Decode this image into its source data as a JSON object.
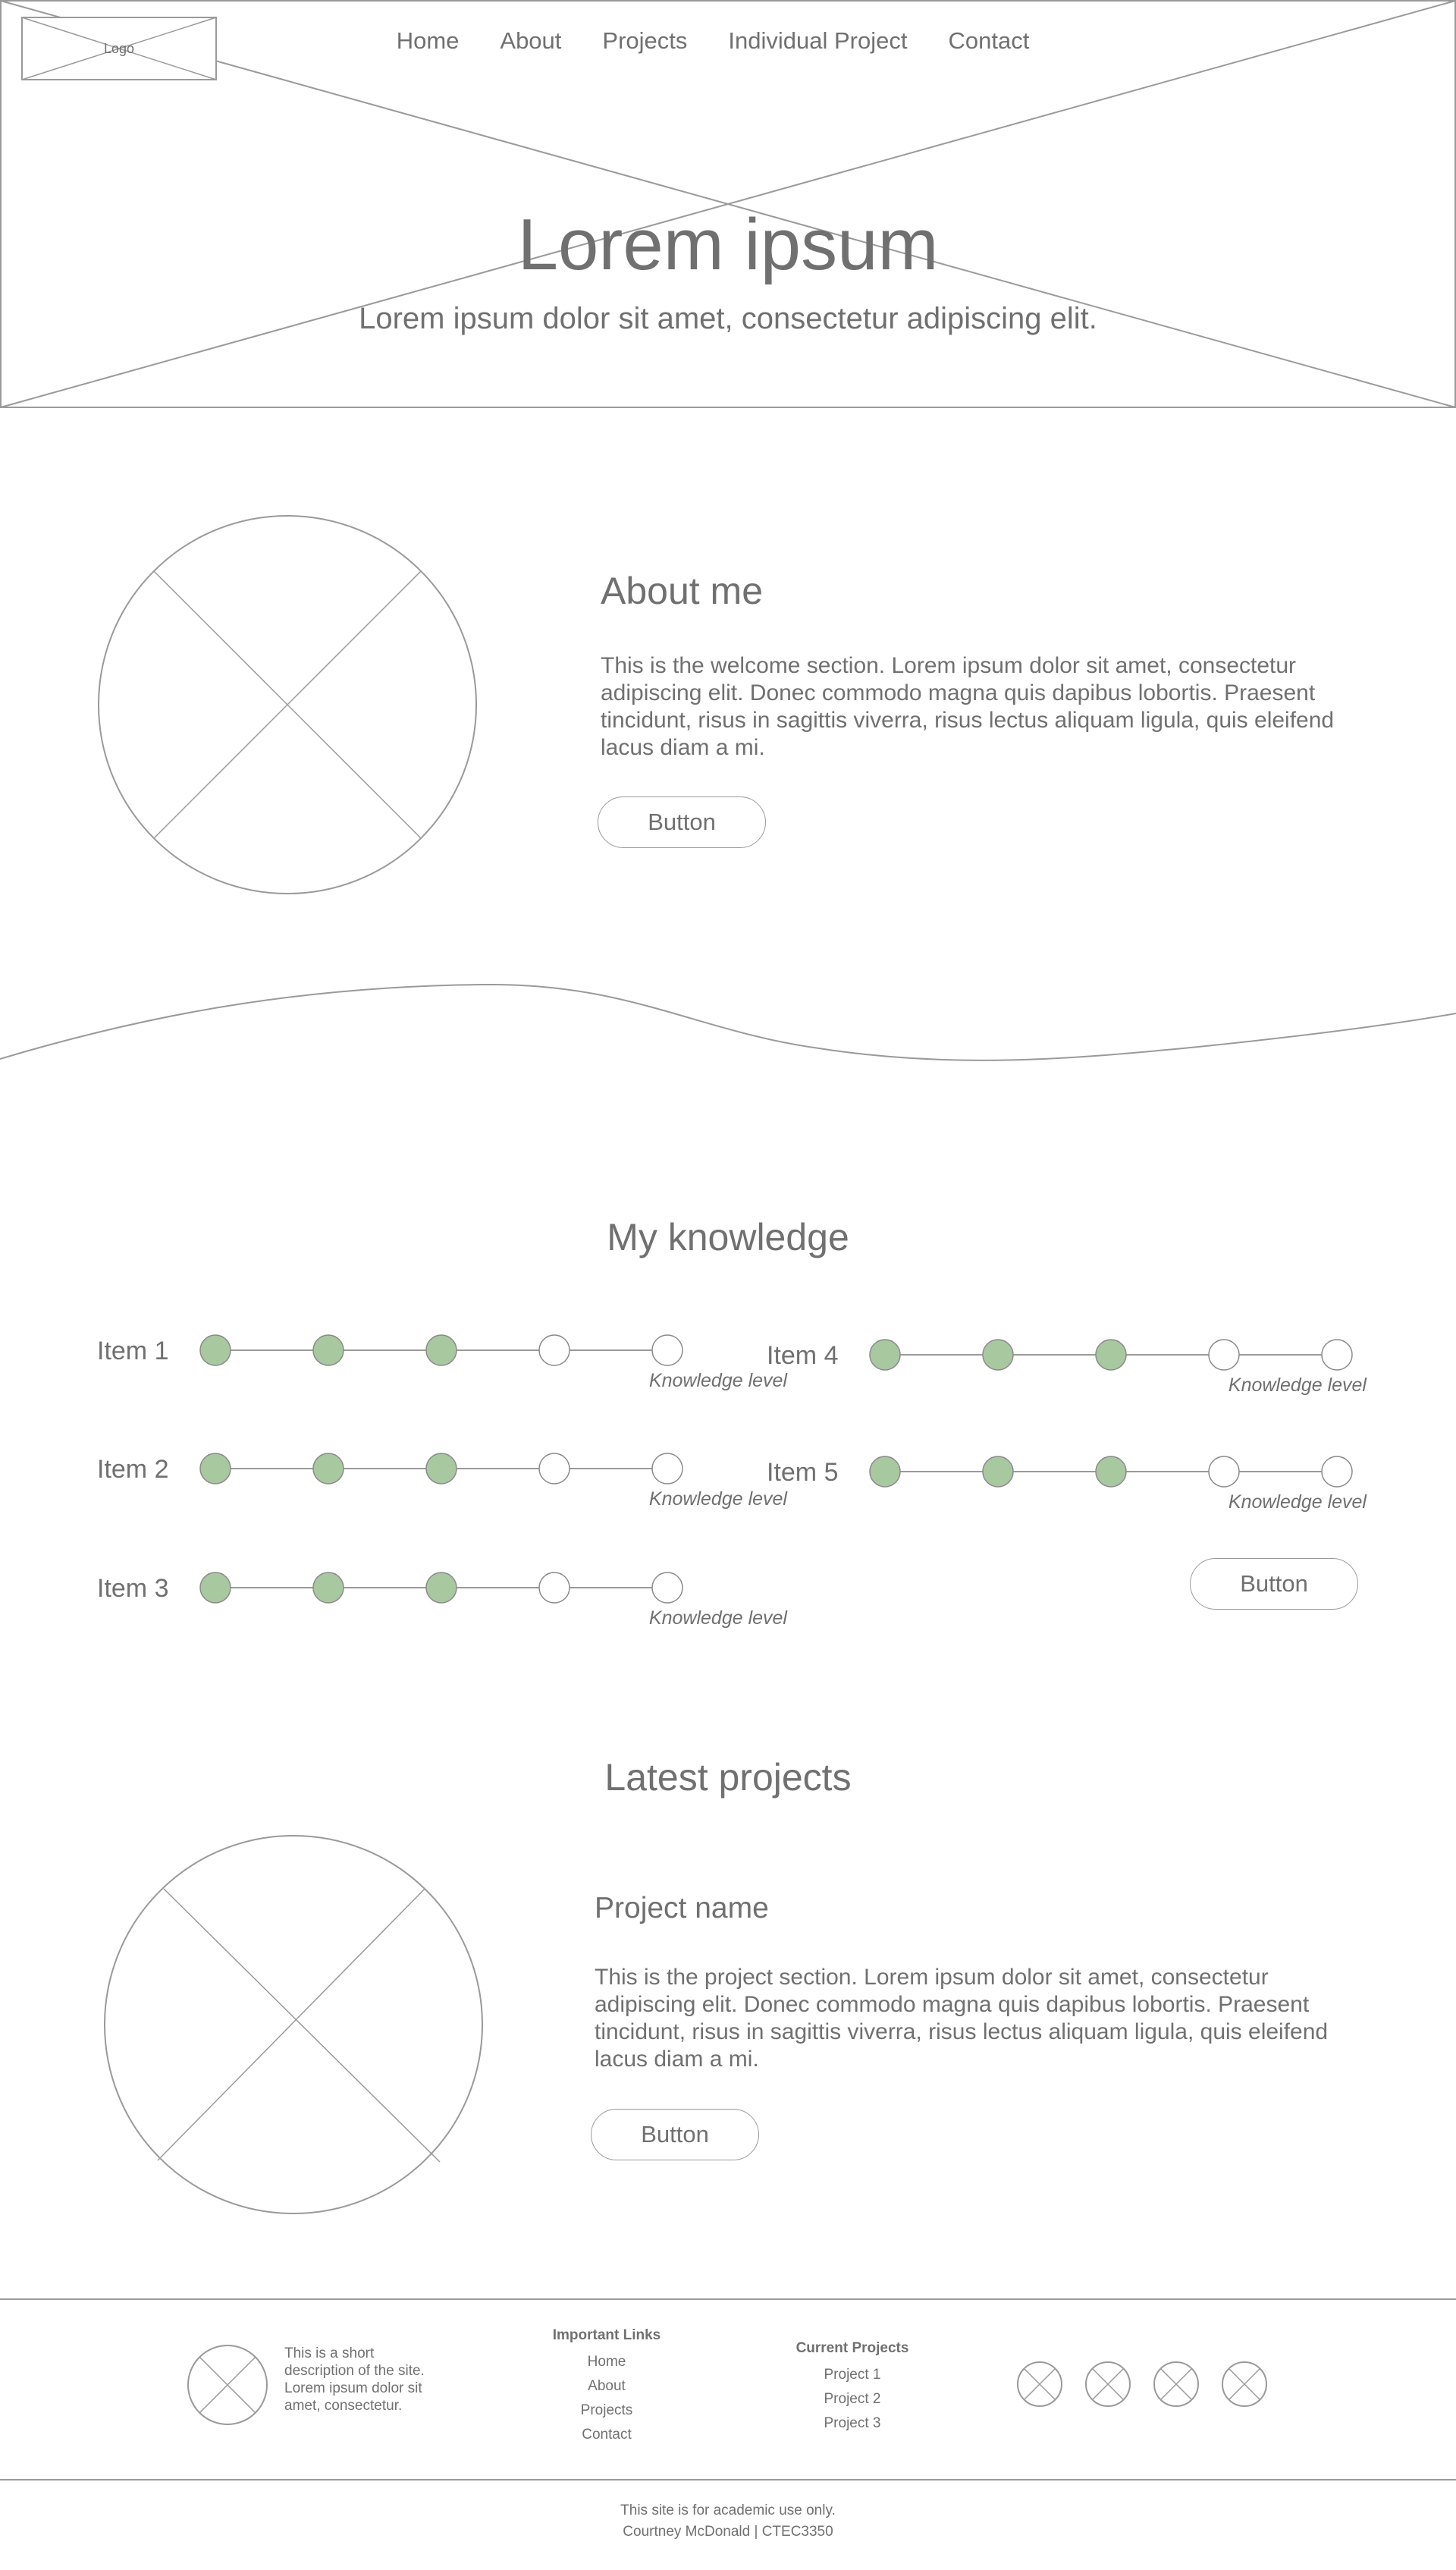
{
  "header": {
    "logo_label": "Logo",
    "nav": [
      "Home",
      "About",
      "Projects",
      "Individual Project",
      "Contact"
    ]
  },
  "hero": {
    "title": "Lorem ipsum",
    "subtitle": "Lorem ipsum dolor sit amet, consectetur adipiscing elit."
  },
  "about": {
    "heading": "About me",
    "text": "This is the welcome section. Lorem ipsum dolor sit amet, consectetur adipiscing elit. Donec commodo magna quis dapibus lobortis. Praesent tincidunt, risus in sagittis viverra, risus lectus aliquam ligula, quis eleifend lacus diam a mi.",
    "button": "Button"
  },
  "knowledge": {
    "heading": "My knowledge",
    "level_label": "Knowledge level",
    "max_level": 5,
    "items": [
      {
        "label": "Item 1",
        "level": 3
      },
      {
        "label": "Item 2",
        "level": 3
      },
      {
        "label": "Item 3",
        "level": 3
      },
      {
        "label": "Item 4",
        "level": 3
      },
      {
        "label": "Item 5",
        "level": 3
      }
    ],
    "button": "Button",
    "filled_color": "#a8c8a0"
  },
  "projects": {
    "heading": "Latest projects",
    "project_name": "Project name",
    "text": "This is the project section. Lorem ipsum dolor sit amet, consectetur adipiscing elit. Donec commodo magna quis dapibus lobortis. Praesent tincidunt, risus in sagittis viverra, risus lectus aliquam ligula, quis eleifend lacus diam a mi.",
    "button": "Button"
  },
  "footer": {
    "description": "This is a short description of the site. Lorem ipsum dolor sit amet, consectetur.",
    "important_links": {
      "title": "Important Links",
      "links": [
        "Home",
        "About",
        "Projects",
        "Contact"
      ]
    },
    "current_projects": {
      "title": "Current Projects",
      "links": [
        "Project 1",
        "Project 2",
        "Project 3"
      ]
    },
    "social_icons": [
      "social-icon-1",
      "social-icon-2",
      "social-icon-3",
      "social-icon-4"
    ],
    "bottom_line_1": "This site is for academic use only.",
    "bottom_line_2": "Courtney McDonald | CTEC3350"
  }
}
